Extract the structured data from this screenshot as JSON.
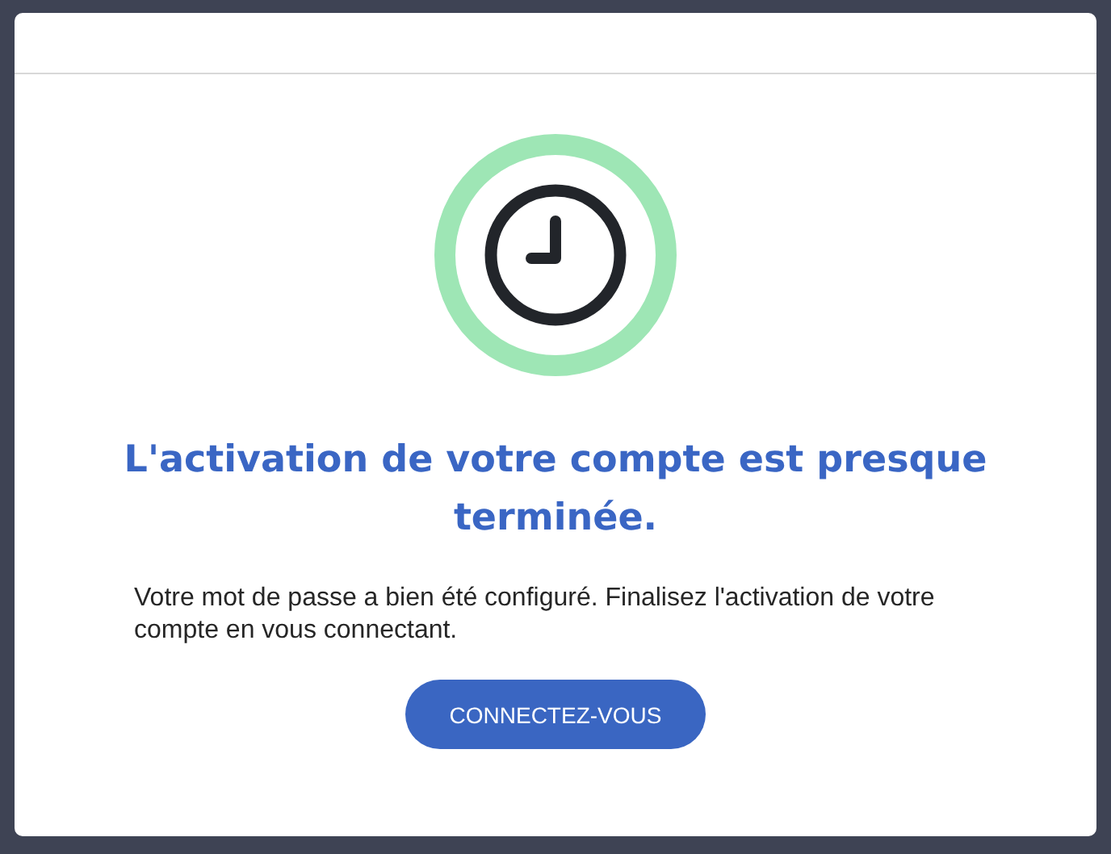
{
  "title": "L'activation de votre compte est presque terminée.",
  "message": "Votre mot de passe a bien été configuré. Finalisez l'activation de votre compte en vous connectant.",
  "button": "CONNECTEZ-VOUS"
}
